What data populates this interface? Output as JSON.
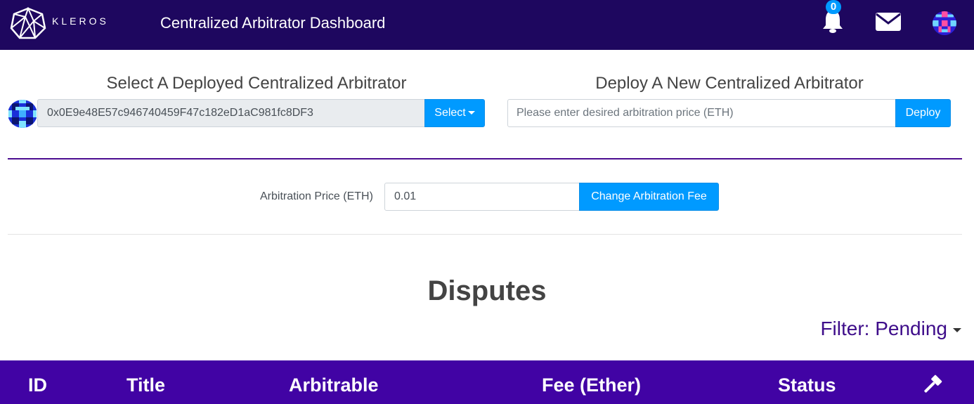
{
  "nav": {
    "brand": "KLEROS",
    "title": "Centralized Arbitrator Dashboard",
    "notification_count": "0",
    "icons": [
      "kleros-logo-icon",
      "bell-icon",
      "mail-icon",
      "identicon-avatar"
    ]
  },
  "select_section": {
    "heading": "Select A Deployed Centralized Arbitrator",
    "address": "0x0E9e48E57c946740459F47c182eD1aC981fc8DF3",
    "select_label": "Select"
  },
  "deploy_section": {
    "heading": "Deploy A New Centralized Arbitrator",
    "price_placeholder": "Please enter desired arbitration price (ETH)",
    "deploy_label": "Deploy"
  },
  "fee_section": {
    "label": "Arbitration Price (ETH)",
    "value": "0.01",
    "change_label": "Change Arbitration Fee"
  },
  "disputes": {
    "title": "Disputes",
    "filter_label": "Filter: Pending",
    "columns": [
      "ID",
      "Title",
      "Arbitrable",
      "Fee (Ether)",
      "Status"
    ]
  },
  "colors": {
    "navbar": "#1e075f",
    "accent_blue": "#009aff",
    "table_header": "#4103a4",
    "divider": "#4b0d91"
  }
}
